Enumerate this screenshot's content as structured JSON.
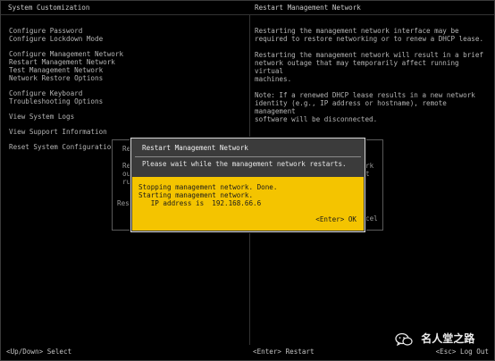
{
  "header": {
    "left_title": "System Customization",
    "right_title": "Restart Management Network"
  },
  "menu": {
    "group1": [
      "Configure Password",
      "Configure Lockdown Mode"
    ],
    "group2": [
      "Configure Management Network",
      "Restart Management Network",
      "Test Management Network",
      "Network Restore Options"
    ],
    "group3": [
      "Configure Keyboard",
      "Troubleshooting Options"
    ],
    "group4": [
      "View System Logs"
    ],
    "group5": [
      "View Support Information"
    ],
    "group6": [
      "Reset System Configuration"
    ]
  },
  "description": {
    "p1": [
      "Restarting the management network interface may be",
      "required to restore networking or to renew a DHCP lease."
    ],
    "p2": [
      "Restarting the management network will result in a brief",
      "network outage that may temporarily affect running virtual",
      "machines."
    ],
    "p3": [
      "Note: If a renewed DHCP lease results in a new network",
      "identity (e.g., IP address or hostname), remote management",
      "software will be disconnected."
    ]
  },
  "background_dialog": {
    "frag_re1": "Re",
    "frag_re2": "Re",
    "frag_ou": "ou",
    "frag_ru": "ru",
    "frag_res": "Res",
    "frag_rk": "rk",
    "frag_t": "t",
    "frag_cel": "cel"
  },
  "dialog": {
    "title": "Restart Management Network",
    "message": "Please wait while the management network restarts.",
    "line1": "Stopping management network. Done.",
    "line2": "Starting management network.",
    "line3": "   IP address is  192.168.66.6",
    "ok_label": "<Enter> OK"
  },
  "footer": {
    "left": "<Up/Down> Select",
    "middle": "<Enter> Restart",
    "right": "<Esc> Log Out"
  },
  "watermark": {
    "text": "名人堂之路",
    "icon": "wechat-icon"
  }
}
